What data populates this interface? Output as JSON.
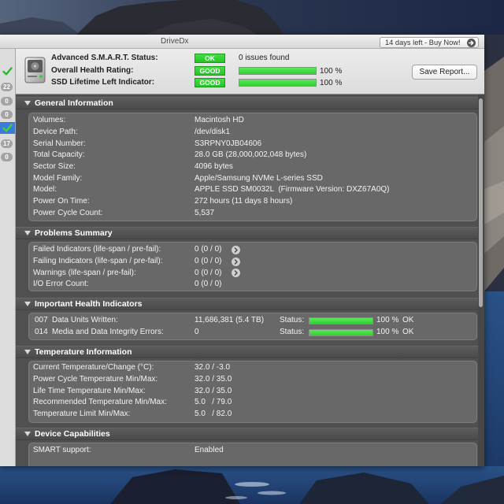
{
  "window": {
    "title": "DriveDx",
    "buy_button": "14 days left - Buy Now!"
  },
  "colors": {
    "ok_green": "#25c425",
    "progress_green": "#2fd32f",
    "selection_blue": "#3d7bd9",
    "badge_gray": "#a3a3a3",
    "panel": "#686868",
    "background": "#505050"
  },
  "sidebar": {
    "items": [
      {
        "icon": "green-check-icon"
      },
      {
        "badge": "22"
      },
      {
        "badge": "0"
      },
      {
        "badge": "0"
      },
      {
        "icon": "green-check-icon",
        "selected": true
      },
      {
        "badge": "17"
      },
      {
        "badge": "0"
      }
    ]
  },
  "header": {
    "drive_icon": "internal-drive-icon",
    "smart_status": {
      "label": "Advanced S.M.A.R.T. Status:",
      "badge": "OK",
      "summary": "0 issues found"
    },
    "health_rating": {
      "label": "Overall Health Rating:",
      "badge": "GOOD",
      "progress": 1.0,
      "percent": "100 %"
    },
    "lifetime_left": {
      "label": "SSD Lifetime Left Indicator:",
      "badge": "GOOD",
      "progress": 1.0,
      "percent": "100 %"
    },
    "save_button": "Save Report..."
  },
  "sections": {
    "general": {
      "title": "General Information",
      "rows": [
        {
          "label": "Volumes:",
          "value": "Macintosh HD"
        },
        {
          "label": "Device Path:",
          "value": "/dev/disk1"
        },
        {
          "label": "Serial Number:",
          "value": "S3RPNY0JB04606"
        },
        {
          "label": "Total Capacity:",
          "value": "28.0 GB (28,000,002,048 bytes)"
        },
        {
          "label": "Sector Size:",
          "value": "4096 bytes"
        },
        {
          "label": "Model Family:",
          "value": "Apple/Samsung NVMe L-series SSD"
        },
        {
          "label": "Model:",
          "value": "APPLE SSD SM0032L  (Firmware Version: DXZ67A0Q)"
        },
        {
          "label": "Power On Time:",
          "value": "272 hours (11 days 8 hours)"
        },
        {
          "label": "Power Cycle Count:",
          "value": "5,537"
        }
      ]
    },
    "problems": {
      "title": "Problems Summary",
      "rows": [
        {
          "label": "Failed Indicators (life-span / pre-fail):",
          "value": "0 (0 / 0)"
        },
        {
          "label": "Failing Indicators (life-span / pre-fail):",
          "value": "0 (0 / 0)"
        },
        {
          "label": "Warnings (life-span / pre-fail):",
          "value": "0 (0 / 0)"
        },
        {
          "label": "I/O Error Count:",
          "value": "0 (0 / 0)"
        }
      ]
    },
    "health": {
      "title": "Important Health Indicators",
      "rows": [
        {
          "id": "007",
          "label": "Data Units Written:",
          "value": "11,686,381 (5.4 TB)",
          "status_label": "Status:",
          "progress": 1.0,
          "percent": "100 %",
          "status": "OK"
        },
        {
          "id": "014",
          "label": "Media and Data Integrity Errors:",
          "value": "0",
          "status_label": "Status:",
          "progress": 1.0,
          "percent": "100 %",
          "status": "OK"
        }
      ]
    },
    "temperature": {
      "title": "Temperature Information",
      "rows": [
        {
          "label": "Current Temperature/Change (°C):",
          "value": "32.0 / -3.0"
        },
        {
          "label": "Power Cycle Temperature Min/Max:",
          "value": "32.0 / 35.0"
        },
        {
          "label": "Life Time Temperature Min/Max:",
          "value": "32.0 / 35.0"
        },
        {
          "label": "Recommended Temperature Min/Max:",
          "value": "5.0   / 79.0"
        },
        {
          "label": "Temperature Limit Min/Max:",
          "value": "5.0   / 82.0"
        }
      ]
    },
    "capabilities": {
      "title": "Device Capabilities",
      "rows": [
        {
          "label": "SMART support:",
          "value": "Enabled"
        }
      ]
    }
  }
}
